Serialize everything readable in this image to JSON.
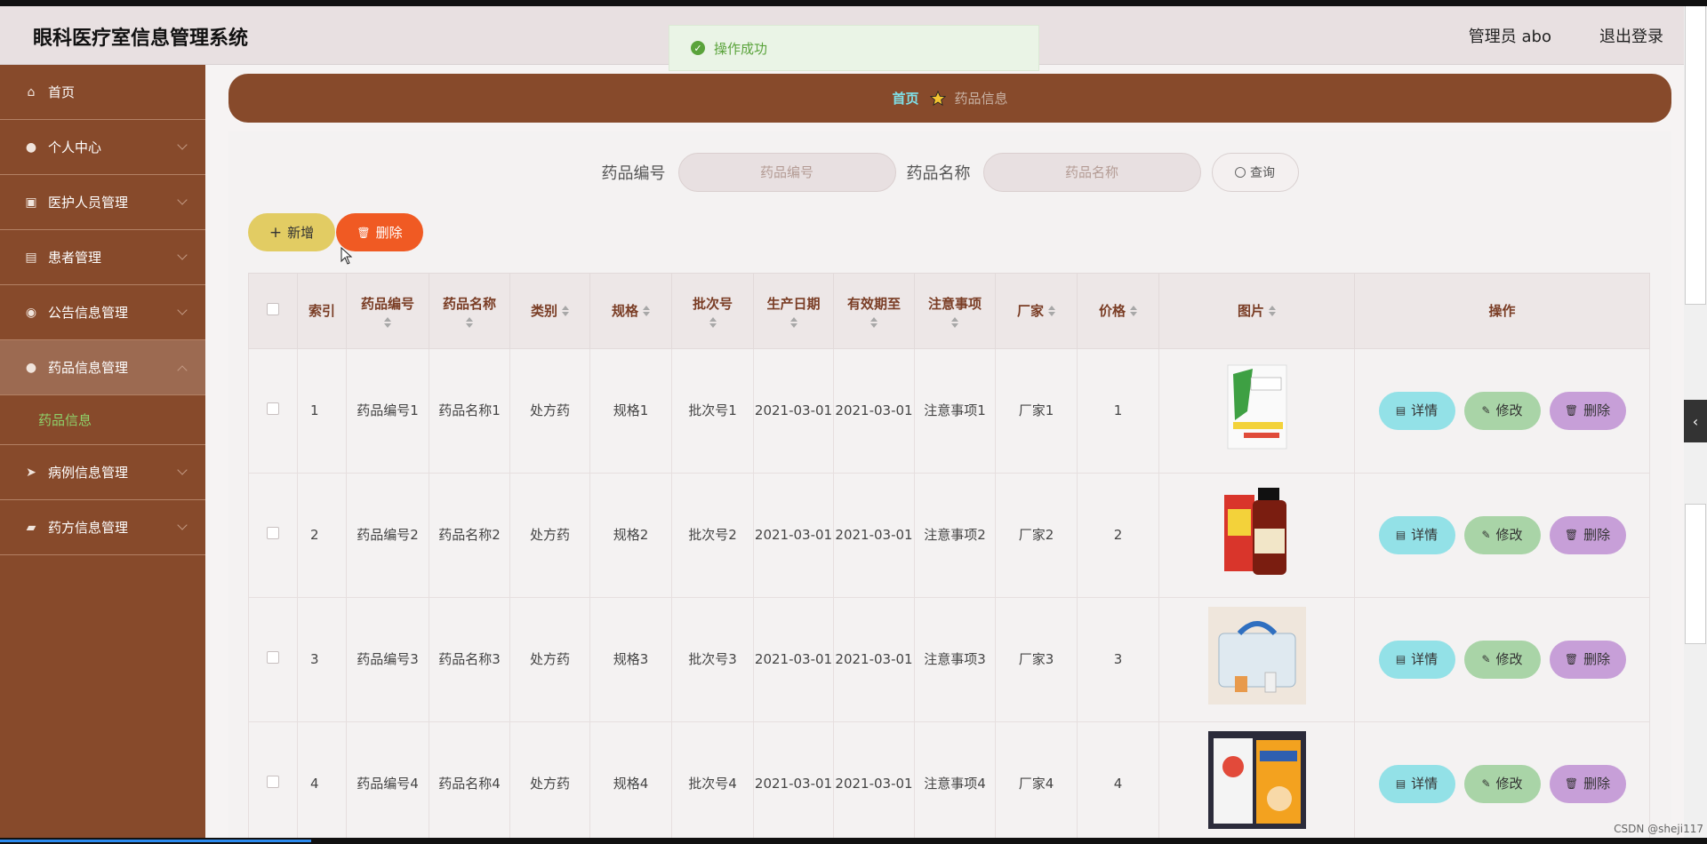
{
  "header": {
    "title": "眼科医疗室信息管理系统",
    "user": "管理员 abo",
    "logout": "退出登录"
  },
  "toast": {
    "text": "操作成功"
  },
  "sidebar": {
    "items": [
      {
        "label": "首页",
        "icon": "home-icon"
      },
      {
        "label": "个人中心",
        "icon": "user-icon"
      },
      {
        "label": "医护人员管理",
        "icon": "briefcase-icon"
      },
      {
        "label": "患者管理",
        "icon": "notebook-icon"
      },
      {
        "label": "公告信息管理",
        "icon": "info-icon"
      },
      {
        "label": "药品信息管理",
        "icon": "user-icon"
      },
      {
        "label": "病例信息管理",
        "icon": "send-icon"
      },
      {
        "label": "药方信息管理",
        "icon": "folder-icon"
      }
    ],
    "sub_active": "药品信息"
  },
  "breadcrumb": {
    "home": "首页",
    "current": "药品信息"
  },
  "search": {
    "label1": "药品编号",
    "placeholder1": "药品编号",
    "label2": "药品名称",
    "placeholder2": "药品名称",
    "query": "查询"
  },
  "toolbar": {
    "add": "新增",
    "delete": "删除"
  },
  "table": {
    "headers": [
      "索引",
      "药品编号",
      "药品名称",
      "类别",
      "规格",
      "批次号",
      "生产日期",
      "有效期至",
      "注意事项",
      "厂家",
      "价格",
      "图片",
      "操作"
    ],
    "rows": [
      {
        "idx": "1",
        "code": "药品编号1",
        "name": "药品名称1",
        "type": "处方药",
        "spec": "规格1",
        "batch": "批次号1",
        "prod": "2021-03-01",
        "exp": "2021-03-01",
        "note": "注意事项1",
        "maker": "厂家1",
        "price": "1"
      },
      {
        "idx": "2",
        "code": "药品编号2",
        "name": "药品名称2",
        "type": "处方药",
        "spec": "规格2",
        "batch": "批次号2",
        "prod": "2021-03-01",
        "exp": "2021-03-01",
        "note": "注意事项2",
        "maker": "厂家2",
        "price": "2"
      },
      {
        "idx": "3",
        "code": "药品编号3",
        "name": "药品名称3",
        "type": "处方药",
        "spec": "规格3",
        "batch": "批次号3",
        "prod": "2021-03-01",
        "exp": "2021-03-01",
        "note": "注意事项3",
        "maker": "厂家3",
        "price": "3"
      },
      {
        "idx": "4",
        "code": "药品编号4",
        "name": "药品名称4",
        "type": "处方药",
        "spec": "规格4",
        "batch": "批次号4",
        "prod": "2021-03-01",
        "exp": "2021-03-01",
        "note": "注意事项4",
        "maker": "厂家4",
        "price": "4"
      }
    ],
    "actions": {
      "detail": "详情",
      "edit": "修改",
      "remove": "删除"
    }
  },
  "watermark": "CSDN @sheji117",
  "colors": {
    "brand": "#874a2b",
    "accent_green": "#8ed16a",
    "danger": "#f05a23",
    "add": "#e2cc63"
  }
}
